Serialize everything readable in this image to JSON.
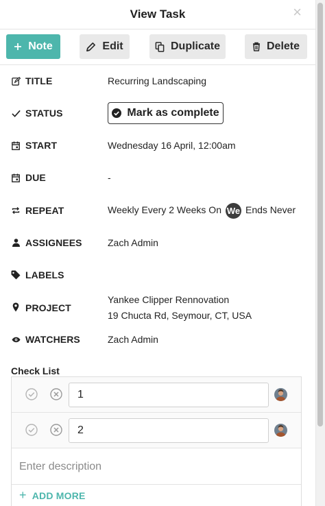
{
  "header": {
    "title": "View Task",
    "close_glyph": "×"
  },
  "toolbar": {
    "note_label": "Note",
    "edit_label": "Edit",
    "duplicate_label": "Duplicate",
    "delete_label": "Delete"
  },
  "fields": {
    "title": {
      "label": "TITLE",
      "value": "Recurring Landscaping"
    },
    "status": {
      "label": "STATUS",
      "button_label": "Mark as complete"
    },
    "start": {
      "label": "START",
      "value": "Wednesday 16 April, 12:00am"
    },
    "due": {
      "label": "DUE",
      "value": "-"
    },
    "repeat": {
      "label": "REPEAT",
      "prefix": "Weekly Every 2 Weeks On",
      "day": "We",
      "suffix": "Ends Never"
    },
    "assignees": {
      "label": "ASSIGNEES",
      "value": "Zach Admin"
    },
    "labels": {
      "label": "LABELS",
      "value": ""
    },
    "project": {
      "label": "PROJECT",
      "name": "Yankee Clipper Rennovation",
      "address": "19 Chucta Rd, Seymour, CT, USA"
    },
    "watchers": {
      "label": "WATCHERS",
      "value": "Zach Admin"
    }
  },
  "checklist": {
    "title": "Check List",
    "items": [
      {
        "value": "1"
      },
      {
        "value": "2"
      }
    ],
    "description_placeholder": "Enter description",
    "add_more_label": "ADD MORE"
  },
  "colors": {
    "accent": "#4db6ac",
    "button_grey": "#e9e9e9",
    "badge_dark": "#3d3d3d"
  },
  "icons": {
    "title": "edit-note-icon",
    "status": "checkmark-icon",
    "start": "calendar-icon",
    "due": "calendar-icon",
    "repeat": "repeat-icon",
    "assignees": "person-icon",
    "labels": "tag-icon",
    "project": "map-pin-icon",
    "watchers": "eye-icon"
  }
}
